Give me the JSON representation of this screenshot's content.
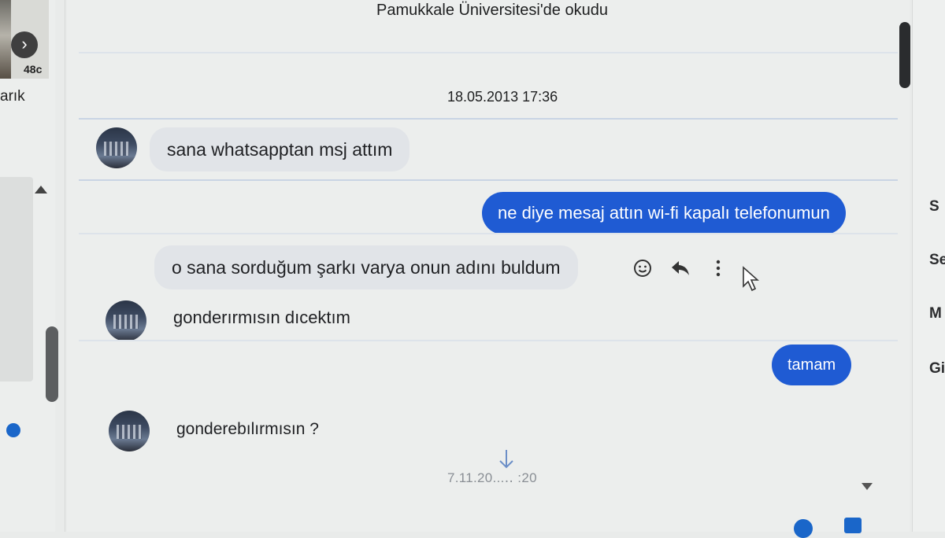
{
  "sidebar": {
    "thumb_count": "48c",
    "label": "arık",
    "next_icon": "chevron-right-icon"
  },
  "chat": {
    "profile_education": "Pamukkale Üniversitesi'de okudu",
    "date_header": "18.05.2013 17:36",
    "messages": [
      {
        "from": "them",
        "text": "sana whatsapptan msj attım"
      },
      {
        "from": "me",
        "text": "ne diye mesaj attın wi-fi kapalı telefonumun"
      },
      {
        "from": "them",
        "text": "o sana sorduğum şarkı varya  onun adını buldum"
      },
      {
        "from": "them",
        "text": "gonderırmısın dıcektım"
      },
      {
        "from": "me",
        "text": "tamam"
      },
      {
        "from": "them",
        "text": "gonderebılırmısın ?"
      }
    ],
    "actions": [
      "smile-icon",
      "reply-icon",
      "more-icon"
    ],
    "bottom_date": "7.11.20...‥ :20"
  },
  "right_panel": {
    "items": [
      "S",
      "Se",
      "M",
      "Giz"
    ]
  },
  "colors": {
    "outgoing": "#1f5bd3",
    "incoming": "#e1e4e8",
    "background": "#eceeed"
  }
}
